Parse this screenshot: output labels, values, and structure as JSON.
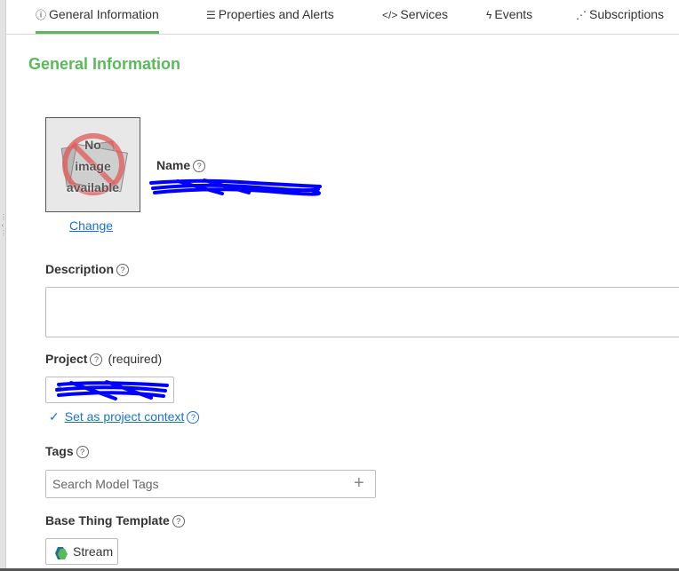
{
  "tabs": [
    {
      "label": "General Information",
      "icon": "info-circle-icon",
      "glyph": "ⓘ",
      "active": true
    },
    {
      "label": "Properties and Alerts",
      "icon": "list-icon",
      "glyph": "☰",
      "active": false
    },
    {
      "label": "Services",
      "icon": "code-icon",
      "glyph": "</>",
      "active": false
    },
    {
      "label": "Events",
      "icon": "bolt-icon",
      "glyph": "ϟ",
      "active": false
    },
    {
      "label": "Subscriptions",
      "icon": "rss-icon",
      "glyph": "⋰",
      "active": false
    }
  ],
  "section_title": "General Information",
  "image": {
    "placeholder_lines": [
      "No",
      "image",
      "available"
    ],
    "change_label": "Change"
  },
  "name": {
    "label": "Name"
  },
  "description": {
    "label": "Description",
    "value": ""
  },
  "project": {
    "label": "Project",
    "required_label": "(required)",
    "set_context_label": "Set as project context"
  },
  "tags": {
    "label": "Tags",
    "placeholder": "Search Model Tags"
  },
  "base_template": {
    "label": "Base Thing Template",
    "value": "Stream"
  },
  "help_glyph": "?",
  "colors": {
    "accent_green": "#5cb85c",
    "link_blue": "#1a73c8",
    "redaction_blue": "#0000ff"
  }
}
